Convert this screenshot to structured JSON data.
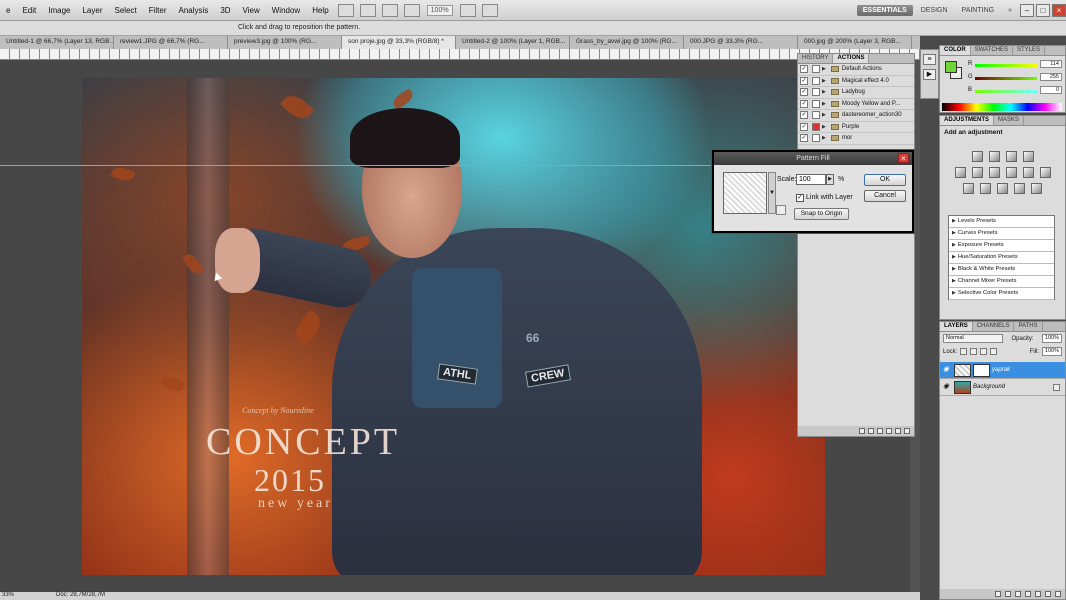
{
  "menubar": {
    "items": [
      "e",
      "Edit",
      "Image",
      "Layer",
      "Select",
      "Filter",
      "Analysis",
      "3D",
      "View",
      "Window",
      "Help"
    ],
    "zoom": "100%",
    "workspaces": [
      "ESSENTIALS",
      "DESIGN",
      "PAINTING"
    ],
    "more": "»"
  },
  "options": {
    "hint": "Click and drag to reposition the pattern."
  },
  "tabs": [
    "Untitled-1 @ 66,7% (Layer 13, RGB...",
    "review1.JPG @ 66,7% (RG...",
    "preview3.jpg @ 100% (RG...",
    "son proje.jpg @ 33,3% (RGB/8) *",
    "Untitled-2 @ 100% (Layer 1, RGB...",
    "Grass_by_avwi.jpg @ 100% (RG...",
    "000.JPG @ 33,3% (RG...",
    "000.jpg @ 200% (Layer 3, RGB..."
  ],
  "canvas": {
    "concept_small": "Concept by Nouredine",
    "concept": "CONCEPT",
    "year": "2015",
    "newyear": "new year",
    "patch_athl": "ATHL",
    "patch_crew": "CREW",
    "patch_66": "66"
  },
  "status": {
    "zoom": "33%",
    "doc": "Doc: 28,7M/28,7M"
  },
  "actions": {
    "tabs": [
      "HISTORY",
      "ACTIONS"
    ],
    "rows": [
      "Default Actions",
      "Magical effect 4.0",
      "Ladybug",
      "Moody Yellow and P...",
      "dastereomer_action30",
      "Purple",
      "mor"
    ]
  },
  "dialog": {
    "title": "Pattern Fill",
    "scale_label": "Scale:",
    "scale_value": "100",
    "scale_unit": "%",
    "link_label": "Link with Layer",
    "snap_label": "Snap to Origin",
    "ok_label": "OK",
    "cancel_label": "Cancel"
  },
  "color": {
    "tabs": [
      "COLOR",
      "SWATCHES",
      "STYLES"
    ],
    "r_label": "R",
    "g_label": "G",
    "b_label": "B",
    "r_value": "114",
    "g_value": "255",
    "b_value": "0",
    "fg": "#72d43c",
    "bg": "#f0f0e8"
  },
  "adjustments": {
    "tabs": [
      "ADJUSTMENTS",
      "MASKS"
    ],
    "title": "Add an adjustment",
    "presets": [
      "Levels Presets",
      "Curves Presets",
      "Exposure Presets",
      "Hue/Saturation Presets",
      "Black & White Presets",
      "Channel Mixer Presets",
      "Selective Color Presets"
    ]
  },
  "layers": {
    "tabs": [
      "LAYERS",
      "CHANNELS",
      "PATHS"
    ],
    "blend": "Normal",
    "opacity_label": "Opacity:",
    "opacity": "100%",
    "lock_label": "Lock:",
    "fill_label": "Fill:",
    "fill": "100%",
    "items": [
      {
        "name": "yaprak",
        "selected": true
      },
      {
        "name": "Background",
        "selected": false
      }
    ]
  }
}
